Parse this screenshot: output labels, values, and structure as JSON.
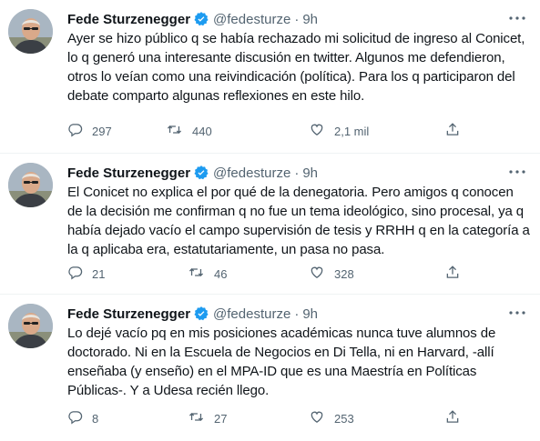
{
  "tweets": [
    {
      "name": "Fede Sturzenegger",
      "handle": "@fedesturze",
      "dot": "·",
      "time": "9h",
      "text": "Ayer se hizo público q se había rechazado mi solicitud de ingreso al Conicet, lo q generó una interesante discusión en twitter. Algunos me defendieron, otros lo veían como una reivindicación (política). Para los q participaron del debate comparto algunas reflexiones en este hilo.",
      "replies": "297",
      "retweets": "440",
      "likes": "2,1 mil"
    },
    {
      "name": "Fede Sturzenegger",
      "handle": "@fedesturze",
      "dot": "·",
      "time": "9h",
      "text": "El Conicet no explica el por qué de la denegatoria. Pero amigos q conocen de la decisión me confirman q no fue un tema ideológico, sino procesal, ya q había dejado vacío el campo supervisión de tesis y RRHH q en la categoría a la q aplicaba era, estatutariamente, un pasa no pasa.",
      "replies": "21",
      "retweets": "46",
      "likes": "328"
    },
    {
      "name": "Fede Sturzenegger",
      "handle": "@fedesturze",
      "dot": "·",
      "time": "9h",
      "text": "Lo dejé vacío pq en mis posiciones académicas nunca tuve alumnos de doctorado. Ni en la Escuela de Negocios en Di Tella, ni en Harvard, -allí enseñaba (y enseño) en el MPA-ID que es una Maestría en Políticas Públicas-. Y a Udesa recién llego.",
      "replies": "8",
      "retweets": "27",
      "likes": "253"
    }
  ],
  "colors": {
    "text": "#0f1419",
    "secondary": "#536471",
    "verified": "#1d9bf0",
    "thread_line": "#cfd9de"
  },
  "icons": [
    "verified-badge-icon",
    "more-icon",
    "reply-icon",
    "retweet-icon",
    "like-icon",
    "share-icon"
  ]
}
